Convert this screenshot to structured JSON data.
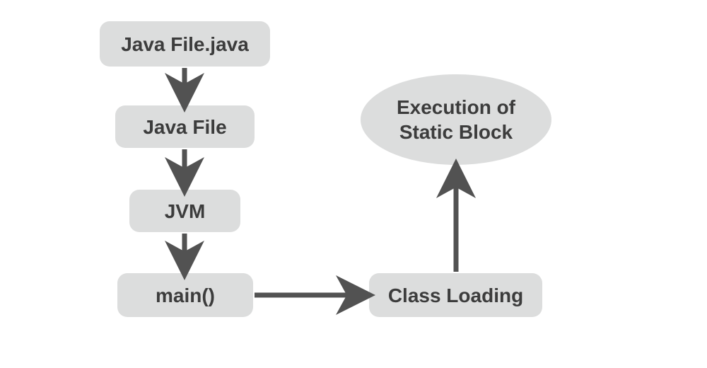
{
  "nodes": {
    "java_file_java": "Java File.java",
    "java_file": "Java File",
    "jvm": "JVM",
    "main": "main()",
    "class_loading": "Class Loading",
    "execution_static_block": "Execution of\nStatic Block"
  },
  "colors": {
    "node_fill": "#dcdddd",
    "arrow": "#525252",
    "text": "#3c3c3c"
  },
  "flow": [
    [
      "java_file_java",
      "java_file"
    ],
    [
      "java_file",
      "jvm"
    ],
    [
      "jvm",
      "main"
    ],
    [
      "main",
      "class_loading"
    ],
    [
      "class_loading",
      "execution_static_block"
    ]
  ]
}
